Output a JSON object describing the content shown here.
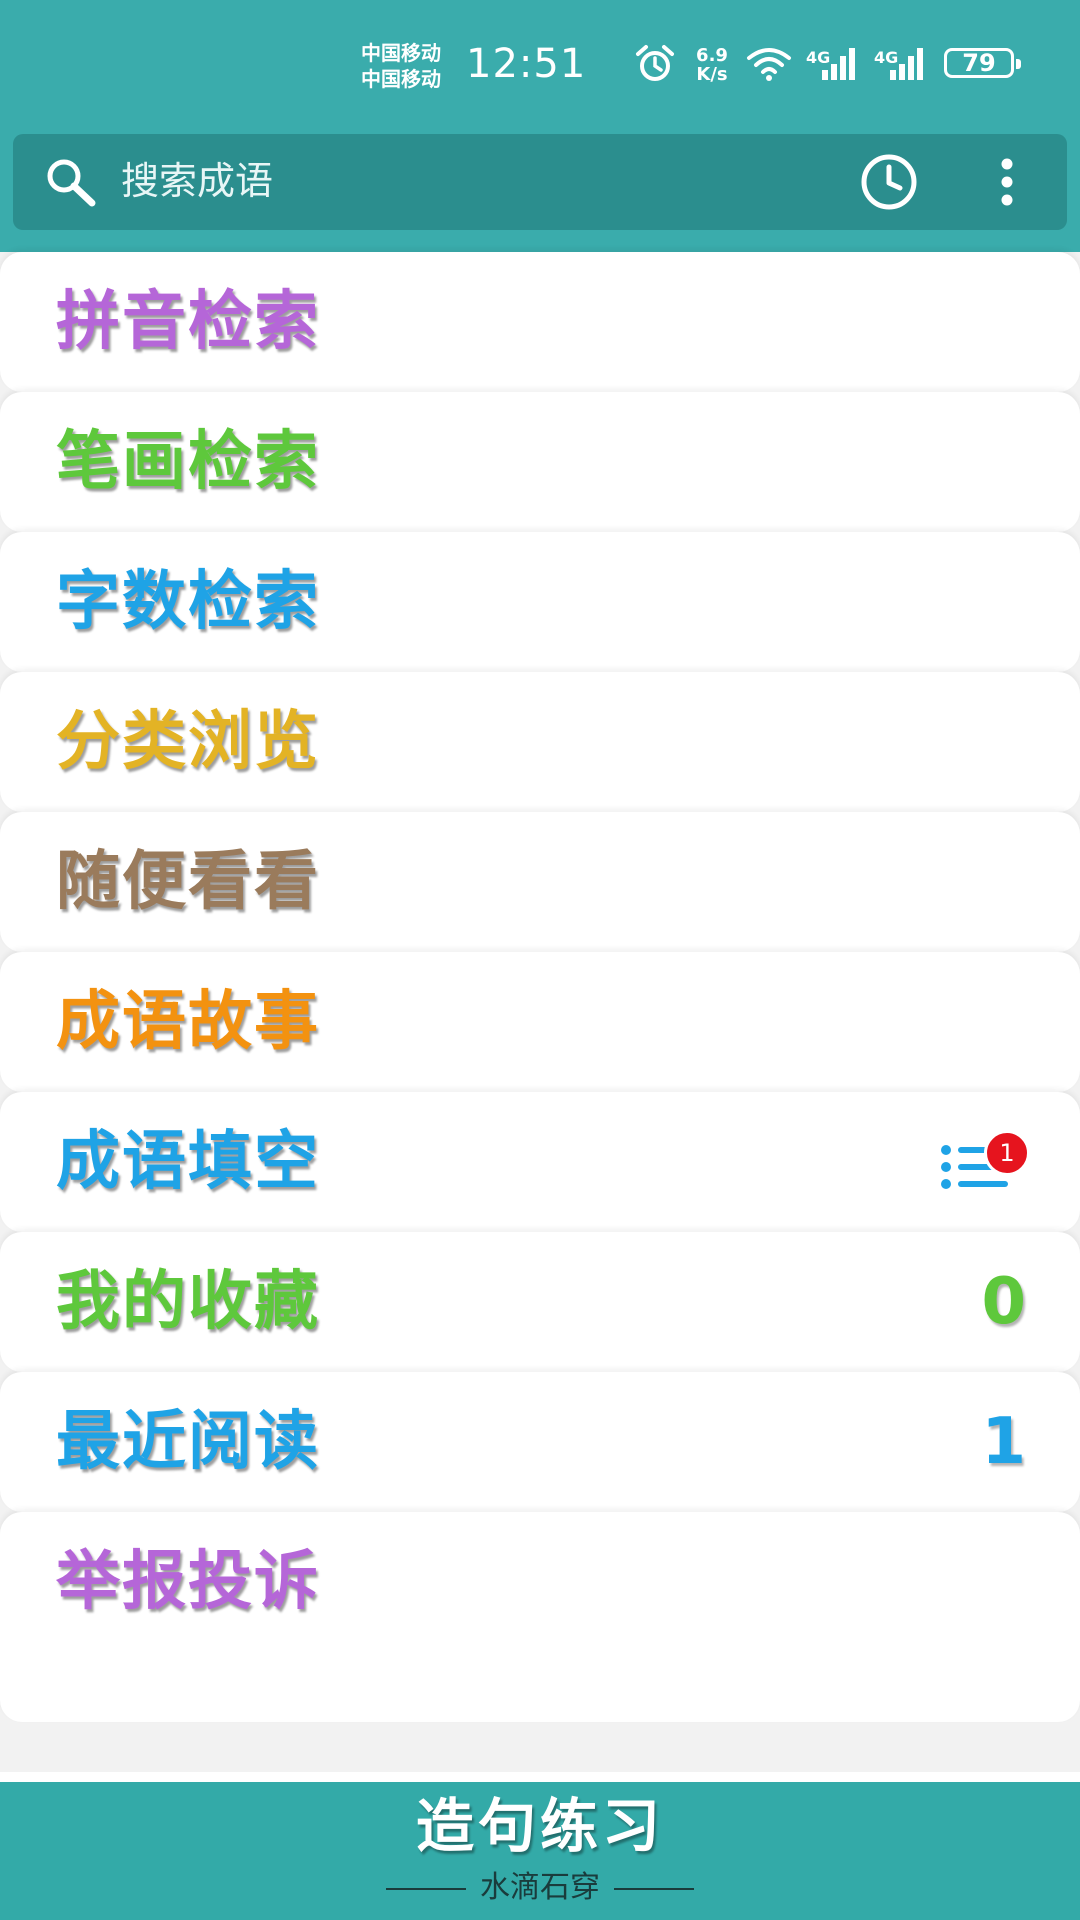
{
  "status_bar": {
    "carrier_1": "中国移动",
    "carrier_2": "中国移动",
    "time": "12:51",
    "speed_value": "6.9",
    "speed_unit": "K/s",
    "network_1": "4G",
    "network_2": "4G",
    "battery": "79"
  },
  "search": {
    "placeholder": "搜索成语"
  },
  "menu": {
    "items": [
      {
        "label": "拼音检索",
        "color": "#b566d8"
      },
      {
        "label": "笔画检索",
        "color": "#5ec83c"
      },
      {
        "label": "字数检索",
        "color": "#1fa3e6"
      },
      {
        "label": "分类浏览",
        "color": "#e3b325"
      },
      {
        "label": "随便看看",
        "color": "#9a7b5c"
      },
      {
        "label": "成语故事",
        "color": "#f39210"
      },
      {
        "label": "成语填空",
        "color": "#1fa3e6",
        "badge": "1"
      },
      {
        "label": "我的收藏",
        "color": "#5ec83c",
        "count": "0"
      },
      {
        "label": "最近阅读",
        "color": "#1fa3e6",
        "count": "1"
      },
      {
        "label": "举报投诉",
        "color": "#b566d8"
      }
    ]
  },
  "footer": {
    "title": "造句练习",
    "subtitle": "水滴石穿"
  }
}
